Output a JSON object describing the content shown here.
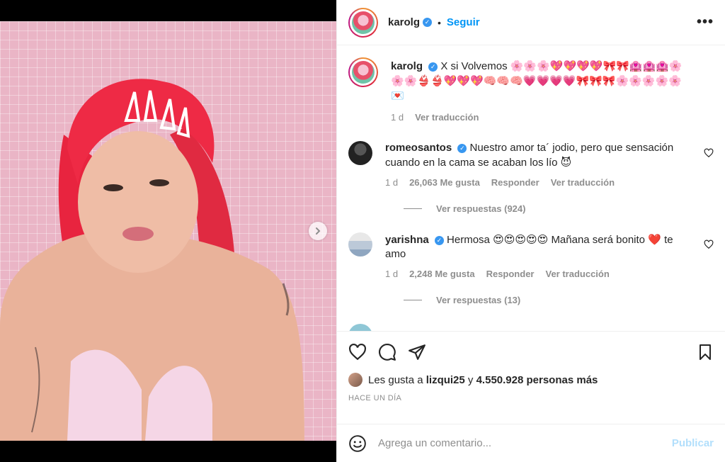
{
  "post": {
    "author": "karolg",
    "follow_label": "Seguir",
    "more_label": "•••"
  },
  "caption": {
    "username": "karolg",
    "text": "X si Volvemos",
    "emojis": "🌸🌸🌸💖💖💖💖🎀🎀🏩🏩🏩🌸🌸🌸👙👙💖💖💖🧠🧠🧠💗💗💗💗🎀🎀🎀🌸🌸🌸🌸🌸💌",
    "time": "1 d",
    "translate": "Ver traducción"
  },
  "comments": [
    {
      "username": "romeosantos",
      "text": "Nuestro amor ta´ jodio, pero que sensación cuando en la cama se acaban los lío",
      "emoji": "😈",
      "time": "1 d",
      "likes": "26,063 Me gusta",
      "reply": "Responder",
      "translate": "Ver traducción",
      "replies_label": "Ver respuestas (924)"
    },
    {
      "username": "yarishna",
      "text": "Hermosa",
      "emoji_mid": "😍😍😍😍😍",
      "text2": "Mañana será bonito",
      "emoji_end": "❤️",
      "text3": "te amo",
      "time": "1 d",
      "likes": "2,248 Me gusta",
      "reply": "Responder",
      "translate": "Ver traducción",
      "replies_label": "Ver respuestas (13)"
    }
  ],
  "likes": {
    "prefix": "Les gusta a",
    "user": "lizqui25",
    "joiner": "y",
    "count": "4.550.928 personas más"
  },
  "time_ago": "HACE UN DÍA",
  "add_comment": {
    "placeholder": "Agrega un comentario...",
    "publish": "Publicar"
  },
  "colors": {
    "accent": "#0095f6",
    "verified": "#3897f0",
    "muted": "#8e8e8e"
  },
  "carousel": {
    "slides": 4,
    "active_index": 0
  }
}
